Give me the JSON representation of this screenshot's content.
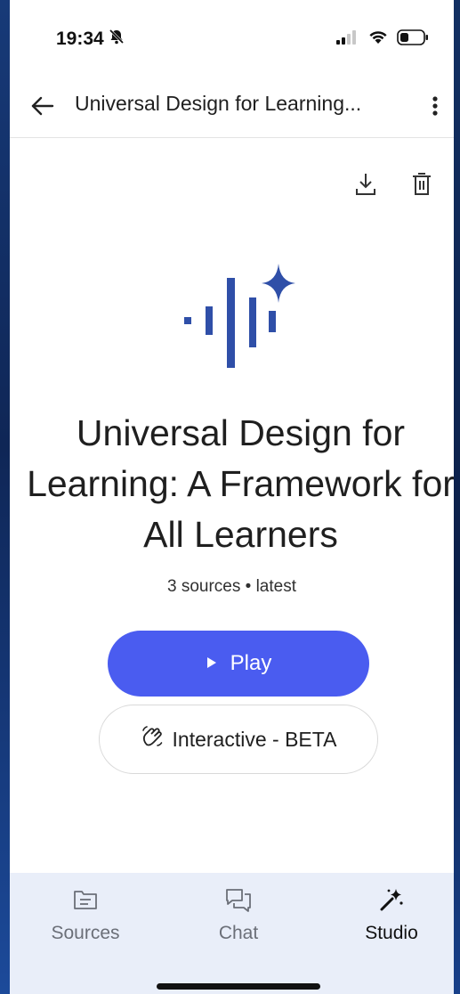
{
  "status_bar": {
    "time": "19:34",
    "icons": [
      "bell-off-icon",
      "signal-icon",
      "wifi-icon",
      "battery-icon"
    ]
  },
  "app_bar": {
    "title": "Universal Design for Learning...",
    "icons": [
      "back-arrow-icon",
      "more-vert-icon"
    ]
  },
  "toolbar": {
    "icons": [
      "download-icon",
      "delete-icon"
    ]
  },
  "audio_overview": {
    "title": "Universal Design for Learning: A Framework for All Learners",
    "meta": "3 sources • latest",
    "play_label": "Play",
    "interactive_label": "Interactive - BETA",
    "accent_color": "#4a5cf0",
    "logo_color": "#2f4fa8"
  },
  "bottom_nav": {
    "items": [
      {
        "label": "Sources",
        "icon": "sources-icon",
        "active": false
      },
      {
        "label": "Chat",
        "icon": "chat-icon",
        "active": false
      },
      {
        "label": "Studio",
        "icon": "studio-wand-icon",
        "active": true
      }
    ],
    "background": "#e9eef9"
  }
}
